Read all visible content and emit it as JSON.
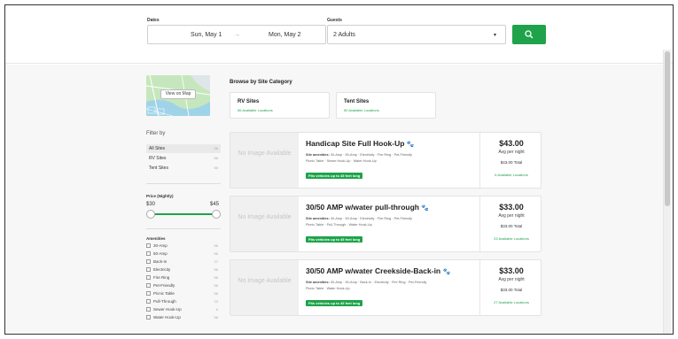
{
  "search": {
    "dates_label": "Dates",
    "check_in": "Sun, May 1",
    "arrow": "→",
    "check_out": "Mon, May 2",
    "guests_label": "Guests",
    "guests_value": "2 Adults",
    "caret": "▾"
  },
  "map": {
    "button_label": "View on Map"
  },
  "categories": {
    "title": "Browse by Site Category",
    "items": [
      {
        "label": "RV Sites",
        "sub": "56 Available Locations"
      },
      {
        "label": "Tent Sites",
        "sub": "50 Available Locations"
      }
    ]
  },
  "filter": {
    "title": "Filter by",
    "items": [
      {
        "label": "All Sites",
        "count": "56"
      },
      {
        "label": "RV Sites",
        "count": "56"
      },
      {
        "label": "Tent Sites",
        "count": "50"
      }
    ],
    "price_title": "Price (Nightly)",
    "price_min": "$30",
    "price_max": "$45",
    "amenities_title": "Amenities",
    "amenities": [
      {
        "label": "30-Amp",
        "count": "56"
      },
      {
        "label": "50-Amp",
        "count": "56"
      },
      {
        "label": "Back-In",
        "count": "27"
      },
      {
        "label": "Electricity",
        "count": "56"
      },
      {
        "label": "Fire Ring",
        "count": "56"
      },
      {
        "label": "Pet-Friendly",
        "count": "56"
      },
      {
        "label": "Picnic Table",
        "count": "56"
      },
      {
        "label": "Pull-Through",
        "count": "23"
      },
      {
        "label": "Sewer Hook-Up",
        "count": "6"
      },
      {
        "label": "Water Hook-Up",
        "count": "56"
      }
    ]
  },
  "listings": [
    {
      "no_image": "No Image Available",
      "title": "Handicap Site Full Hook-Up",
      "paw": "🐾",
      "amenities_label": "Site amenities:",
      "amenities_line1": "30-Amp · 50-Amp · Electricity · Fire Ring · Pet-Friendly",
      "amenities_line2": "Picnic Table · Sewer Hook-Up · Water Hook-Up",
      "fits": "Fits vehicles up to 45 feet long",
      "price": "$43.00",
      "avg": "Avg per night",
      "total": "$43.00 Total",
      "locations": "6 Available Locations"
    },
    {
      "no_image": "No Image Available",
      "title": "30/50 AMP w/water pull-through",
      "paw": "🐾",
      "amenities_label": "Site amenities:",
      "amenities_line1": "30-Amp · 50-Amp · Electricity · Fire Ring · Pet-Friendly",
      "amenities_line2": "Picnic Table · Pull-Through · Water Hook-Up",
      "fits": "Fits vehicles up to 45 feet long",
      "price": "$33.00",
      "avg": "Avg per night",
      "total": "$33.00 Total",
      "locations": "23 Available Locations"
    },
    {
      "no_image": "No Image Available",
      "title": "30/50 AMP w/water Creekside-Back-in",
      "paw": "🐾",
      "amenities_label": "Site amenities:",
      "amenities_line1": "30-Amp · 50-Amp · Back-In · Electricity · Fire Ring · Pet-Friendly",
      "amenities_line2": "Picnic Table · Water Hook-Up",
      "fits": "Fits vehicles up to 45 feet long",
      "price": "$33.00",
      "avg": "Avg per night",
      "total": "$33.00 Total",
      "locations": "27 Available Locations"
    }
  ],
  "colors": {
    "accent": "#1ea34a",
    "background": "#f7f7f7"
  }
}
